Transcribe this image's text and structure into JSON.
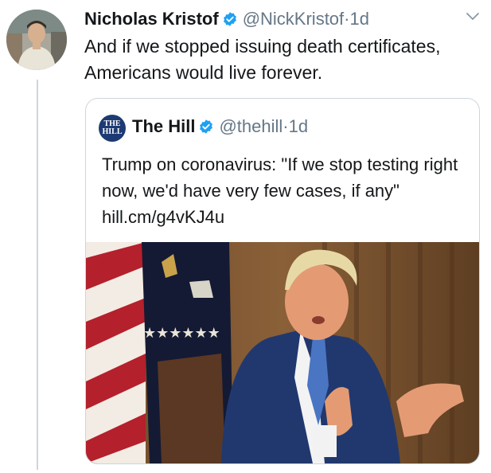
{
  "tweet": {
    "author_name": "Nicholas Kristof",
    "handle": "@NickKristof",
    "separator": "·",
    "time": "1d",
    "text": "And if we stopped issuing death certificates, Americans would live forever."
  },
  "quote": {
    "author_name": "The Hill",
    "handle": "@thehill",
    "separator": "·",
    "time": "1d",
    "avatar_text_line1": "THE",
    "avatar_text_line2": "HILL",
    "text": "Trump on coronavirus: \"If we stop testing right now, we'd have very few cases, if any\" hill.cm/g4vKJ4u"
  },
  "colors": {
    "verified_blue": "#1da1f2",
    "secondary_text": "#657786",
    "border": "#ccd6dd",
    "hill_blue": "#1d3a73"
  },
  "icons": {
    "verified": "verified-badge-icon",
    "caret": "chevron-down-icon"
  }
}
